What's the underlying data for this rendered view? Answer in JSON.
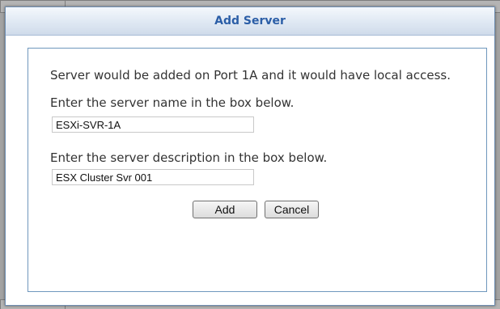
{
  "dialog": {
    "title": "Add Server",
    "info_text": "Server would be added on Port 1A and it would have local access.",
    "name_prompt": "Enter the server name in the box below.",
    "name_value": "ESXi-SVR-1A",
    "description_prompt": "Enter the server description in the box below.",
    "description_value": "ESX Cluster Svr 001",
    "add_label": "Add",
    "cancel_label": "Cancel"
  },
  "colors": {
    "title_text": "#2b5ea7",
    "panel_border": "#6f97bd",
    "dialog_bg": "#ffffff"
  }
}
